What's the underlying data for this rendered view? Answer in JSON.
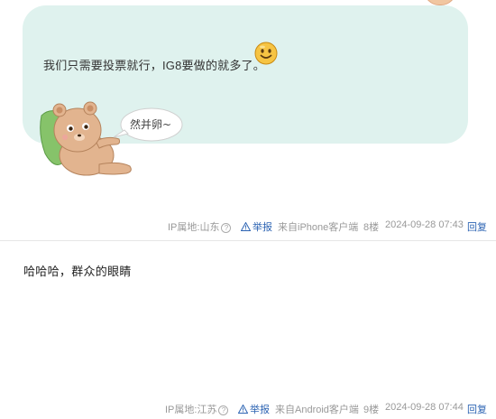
{
  "posts": [
    {
      "content": "我们只需要投票就行，IG8要做的就多了。",
      "sticker_text": "然并卵~",
      "footer": {
        "ip_location": "IP属地:山东",
        "report_label": "举报",
        "source": "来自iPhone客户端",
        "floor": "8楼",
        "timestamp": "2024-09-28 07:43",
        "reply_label": "回复"
      }
    },
    {
      "content": "哈哈哈，群众的眼睛",
      "footer": {
        "ip_location": "IP属地:江苏",
        "report_label": "举报",
        "source": "来自Android客户端",
        "floor": "9楼",
        "timestamp": "2024-09-28 07:44",
        "reply_label": "回复"
      }
    }
  ],
  "icons": {
    "help": "question-circle-icon",
    "report": "warning-triangle-icon",
    "emoji": "smiley-emoji-icon",
    "sticker": "bear-sticker-icon"
  },
  "colors": {
    "bubble_bg": "#dff2ee",
    "link": "#2d64b3",
    "meta_text": "#999999"
  }
}
